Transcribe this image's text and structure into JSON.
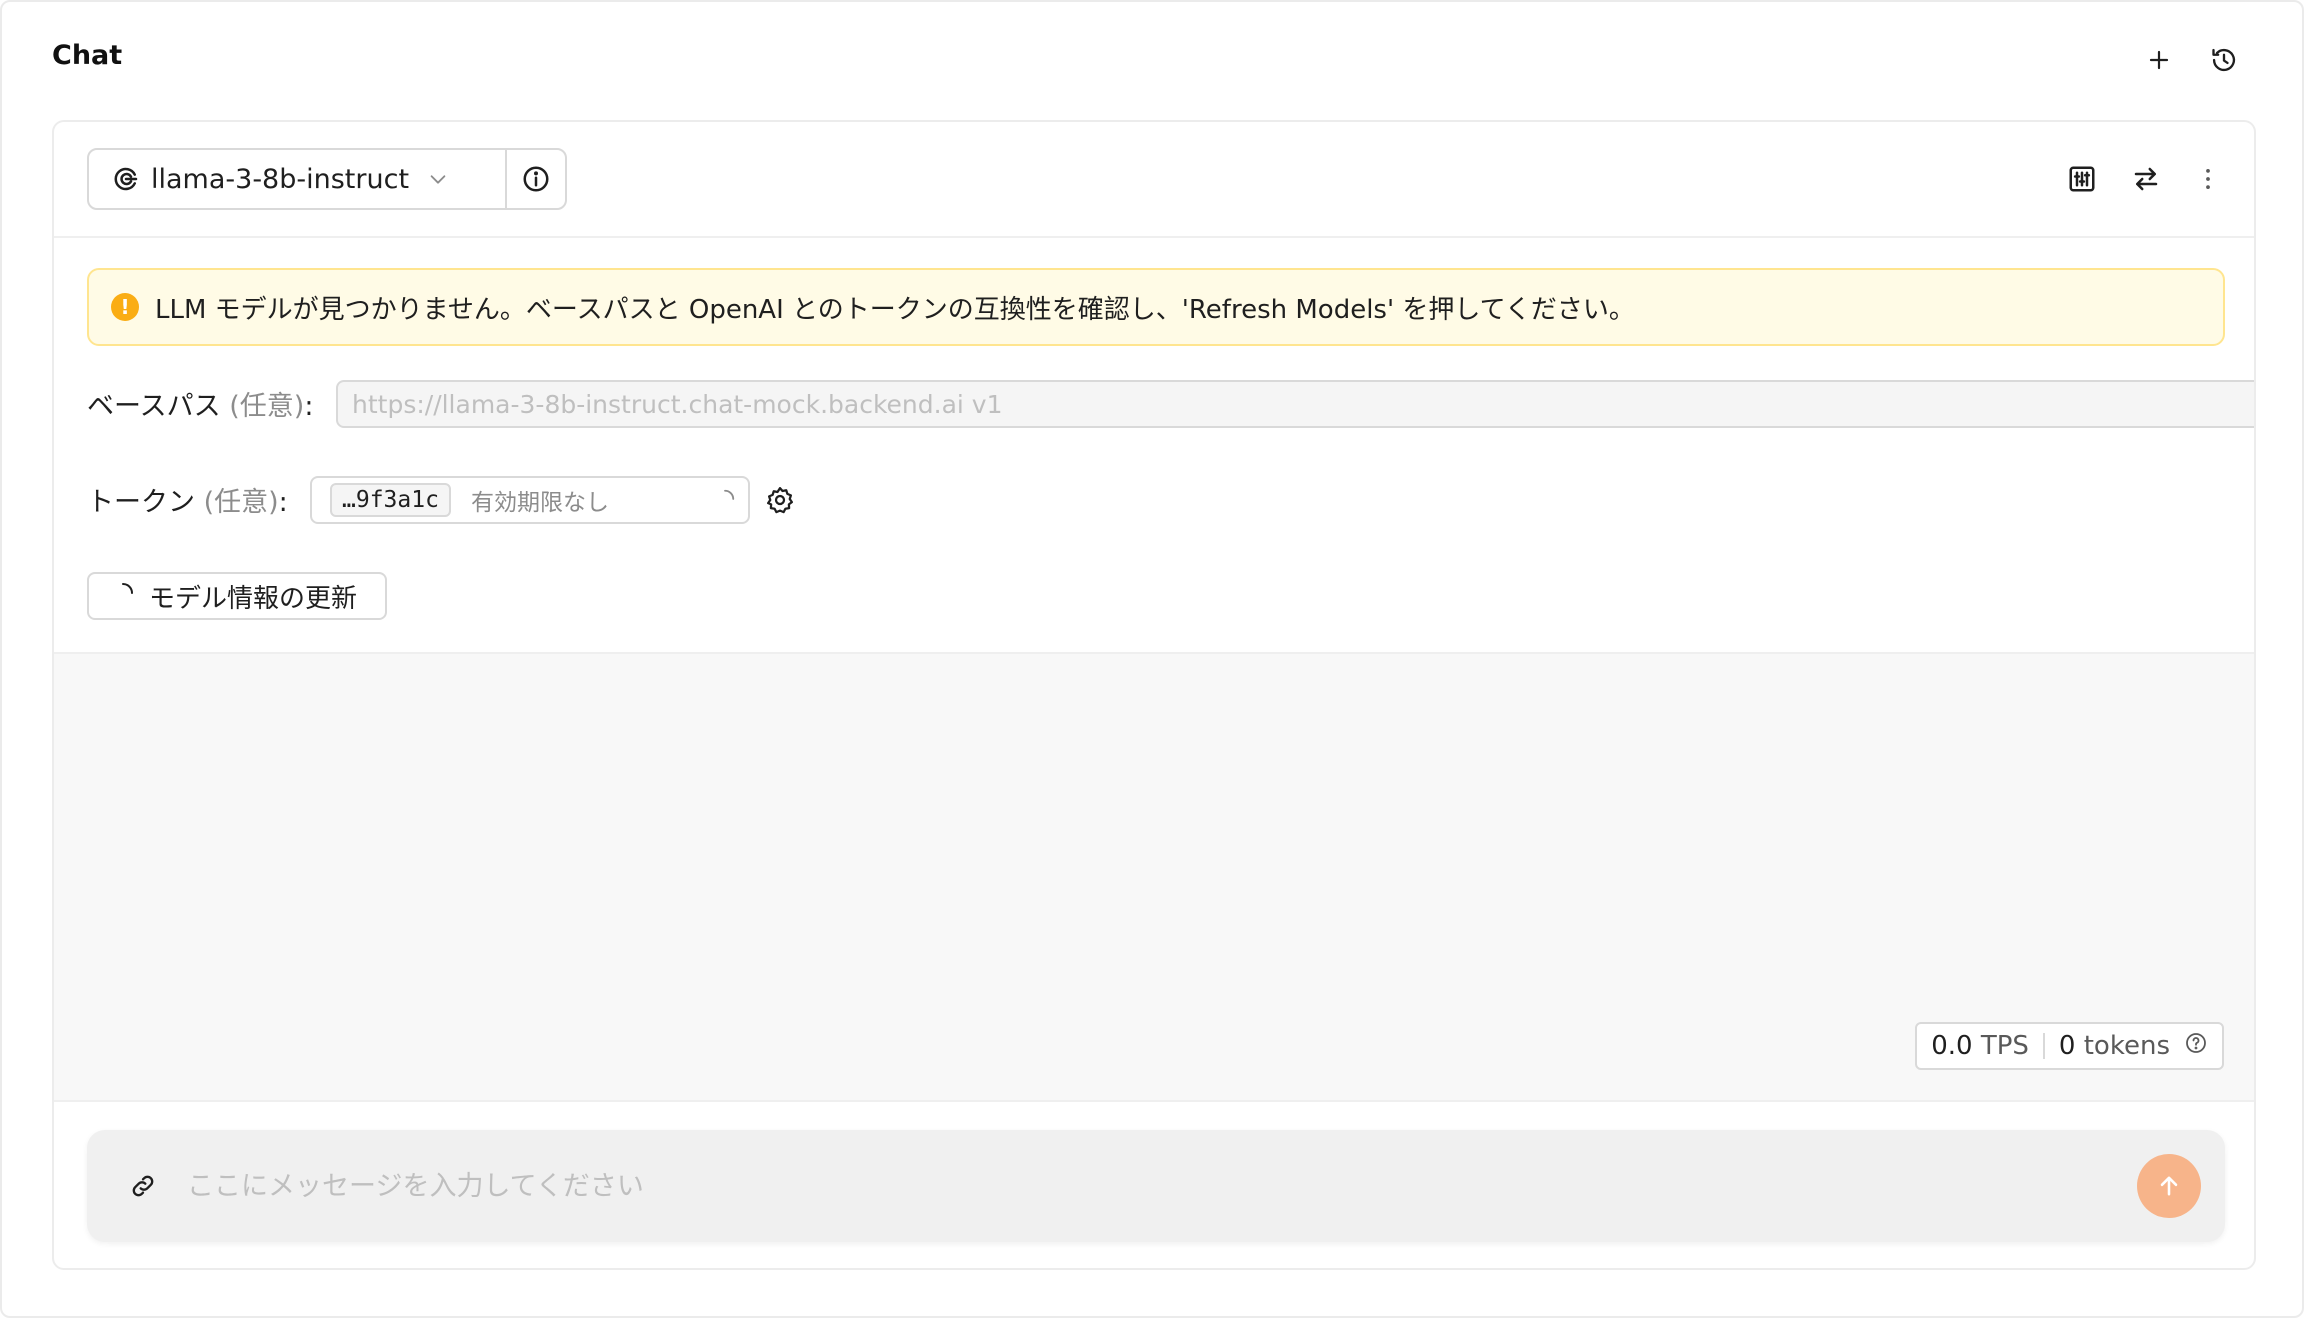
{
  "header": {
    "title": "Chat",
    "new_chat_icon": "plus-icon",
    "history_icon": "history-icon"
  },
  "model_bar": {
    "model_name": "llama-3-8b-instruct",
    "model_icon": "openai-logo-icon",
    "info_icon": "info-circle-icon",
    "tools": [
      "sliders-icon",
      "swap-icon",
      "more-vertical-icon"
    ]
  },
  "alert": {
    "type": "warning",
    "message": "LLM モデルが見つかりません。ベースパスと OpenAI とのトークンの互換性を確認し、'Refresh Models' を押してください。"
  },
  "base_path": {
    "label": "ベースパス",
    "optional": "(任意)",
    "colon": ":",
    "placeholder": "https://llama-3-8b-instruct.chat-mock.backend.ai v1",
    "value": ""
  },
  "token": {
    "label": "トークン",
    "optional": "(任意)",
    "colon": ":",
    "tag": "…9f3a1c",
    "expiry": "有効期限なし"
  },
  "refresh_button": {
    "label": "モデル情報の更新"
  },
  "stats": {
    "tps_value": "0.0",
    "tps_unit": "TPS",
    "tokens_value": "0",
    "tokens_unit": "tokens"
  },
  "composer": {
    "placeholder": "ここにメッセージを入力してください",
    "value": ""
  },
  "colors": {
    "accent": "#f7b48a",
    "warning": "#faad14",
    "warning_bg": "#fffbe6",
    "warning_border": "#ffe58f"
  }
}
